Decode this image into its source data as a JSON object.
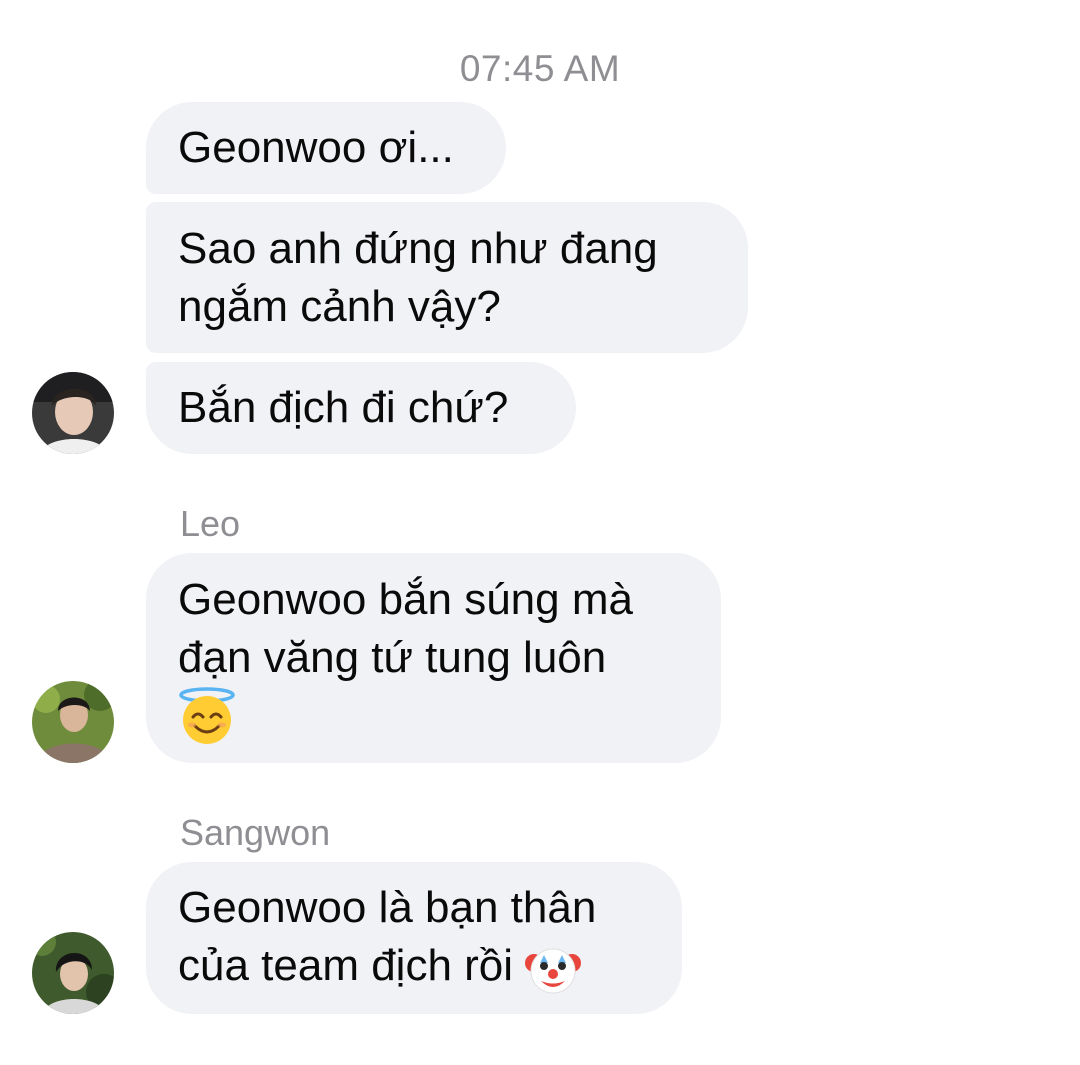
{
  "timestamp": "07:45 AM",
  "groups": [
    {
      "sender": "",
      "avatar": "avatar-person-1",
      "messages": [
        {
          "lines": [
            "Geonwoo ơi..."
          ]
        },
        {
          "lines": [
            "Sao anh đứng như đang",
            "ngắm cảnh vậy?"
          ]
        },
        {
          "lines": [
            "Bắn địch đi chứ?"
          ]
        }
      ]
    },
    {
      "sender": "Leo",
      "avatar": "avatar-leo",
      "messages": [
        {
          "lines": [
            "Geonwoo bắn súng mà",
            "đạn văng tứ tung luôn"
          ],
          "trailing_emoji": "smiling-face-with-halo-emoji"
        }
      ]
    },
    {
      "sender": "Sangwon",
      "avatar": "avatar-sangwon",
      "messages": [
        {
          "lines": [
            "Geonwoo là bạn thân",
            "của team địch rồi"
          ],
          "inline_emoji": "clown-face-emoji"
        }
      ]
    }
  ],
  "colors": {
    "bubble_bg": "#f1f2f6",
    "timestamp": "#8e8e93",
    "sender_name": "#8e8e93",
    "text": "#0a0a0a"
  }
}
